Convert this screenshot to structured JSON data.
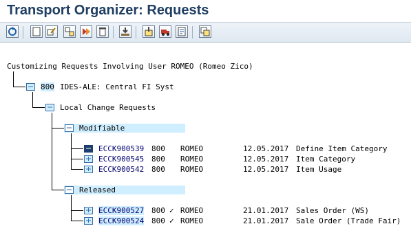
{
  "window": {
    "title": "Transport Organizer: Requests"
  },
  "toolbar": {
    "buttons": [
      "refresh-icon",
      "display-icon",
      "change-icon",
      "expand-icon",
      "collapse-icon",
      "delete-icon",
      "release-icon",
      "import-icon",
      "transport-icon",
      "log-icon",
      "copy-icon"
    ]
  },
  "tree": {
    "header": "Customizing Requests Involving User ROMEO (Romeo Zico)",
    "client_node": {
      "client": "800",
      "text": "IDES-ALE: Central FI Syst"
    },
    "local_node": {
      "text": "Local Change Requests"
    },
    "modifiable": {
      "label": "Modifiable",
      "rows": [
        {
          "id": "ECCK900539",
          "client": "800",
          "check": "",
          "user": "ROMEO",
          "date": "12.05.2017",
          "desc": "Define Item Category"
        },
        {
          "id": "ECCK900545",
          "client": "800",
          "check": "",
          "user": "ROMEO",
          "date": "12.05.2017",
          "desc": "Item Category"
        },
        {
          "id": "ECCK900542",
          "client": "800",
          "check": "",
          "user": "ROMEO",
          "date": "12.05.2017",
          "desc": "Item Usage"
        }
      ]
    },
    "released": {
      "label": "Released",
      "rows": [
        {
          "id": "ECCK900527",
          "client": "800",
          "check": "✓",
          "user": "ROMEO",
          "date": "21.01.2017",
          "desc": "Sales Order (WS)"
        },
        {
          "id": "ECCK900524",
          "client": "800",
          "check": "✓",
          "user": "ROMEO",
          "date": "21.01.2017",
          "desc": "Sale Order (Trade Fair)"
        }
      ]
    }
  },
  "colors": {
    "title": "#1f3e63",
    "highlight": "#cfeeff",
    "folder": "#3a6ea5"
  }
}
